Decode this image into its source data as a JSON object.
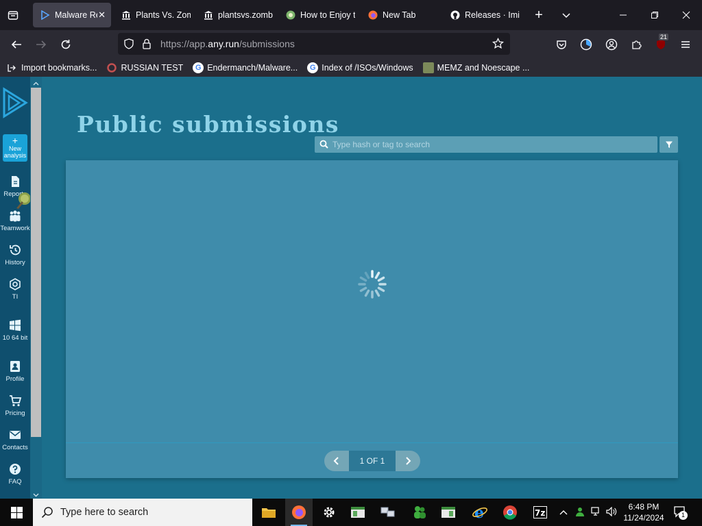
{
  "browser": {
    "tabs": [
      {
        "title": "Malware Re",
        "active": true
      },
      {
        "title": "Plants Vs. Zom",
        "active": false
      },
      {
        "title": "plantsvs.zomb",
        "active": false
      },
      {
        "title": "How to Enjoy t",
        "active": false
      },
      {
        "title": "New Tab",
        "active": false
      },
      {
        "title": "Releases · Imin",
        "active": false
      }
    ],
    "url_prefix": "https://app.",
    "url_domain": "any.run",
    "url_path": "/submissions",
    "extension_badge": "21",
    "bookmarks": [
      {
        "label": "Import bookmarks..."
      },
      {
        "label": "RUSSIAN TEST"
      },
      {
        "label": "Endermanch/Malware..."
      },
      {
        "label": "Index of /ISOs/Windows"
      },
      {
        "label": "MEMZ and Noescape ..."
      }
    ]
  },
  "sidebar": {
    "new_analysis_line1": "New",
    "new_analysis_line2": "analysis",
    "items": [
      {
        "label": "Reports",
        "icon": "document-icon"
      },
      {
        "label": "Teamwork",
        "icon": "team-icon"
      },
      {
        "label": "History",
        "icon": "history-icon"
      },
      {
        "label": "TI",
        "icon": "ti-icon"
      },
      {
        "label": "10 64 bit",
        "icon": "windows-icon"
      },
      {
        "label": "Profile",
        "icon": "profile-icon"
      },
      {
        "label": "Pricing",
        "icon": "cart-icon"
      },
      {
        "label": "Contacts",
        "icon": "mail-icon"
      },
      {
        "label": "FAQ",
        "icon": "help-icon"
      }
    ]
  },
  "main": {
    "title": "Public submissions",
    "search_placeholder": "Type hash or tag to search",
    "pagination_label": "1 OF 1",
    "loading": true
  },
  "taskbar": {
    "search_placeholder": "Type here to search",
    "time": "6:48 PM",
    "date": "11/24/2024",
    "notification_count": "1"
  },
  "colors": {
    "page_bg": "#1b6f8c",
    "panel_bg": "#3f8cab",
    "title": "#8fd3e8",
    "sidebar_bg": "#0f4f6e",
    "accent_new_analysis": "#1aa3d8"
  }
}
